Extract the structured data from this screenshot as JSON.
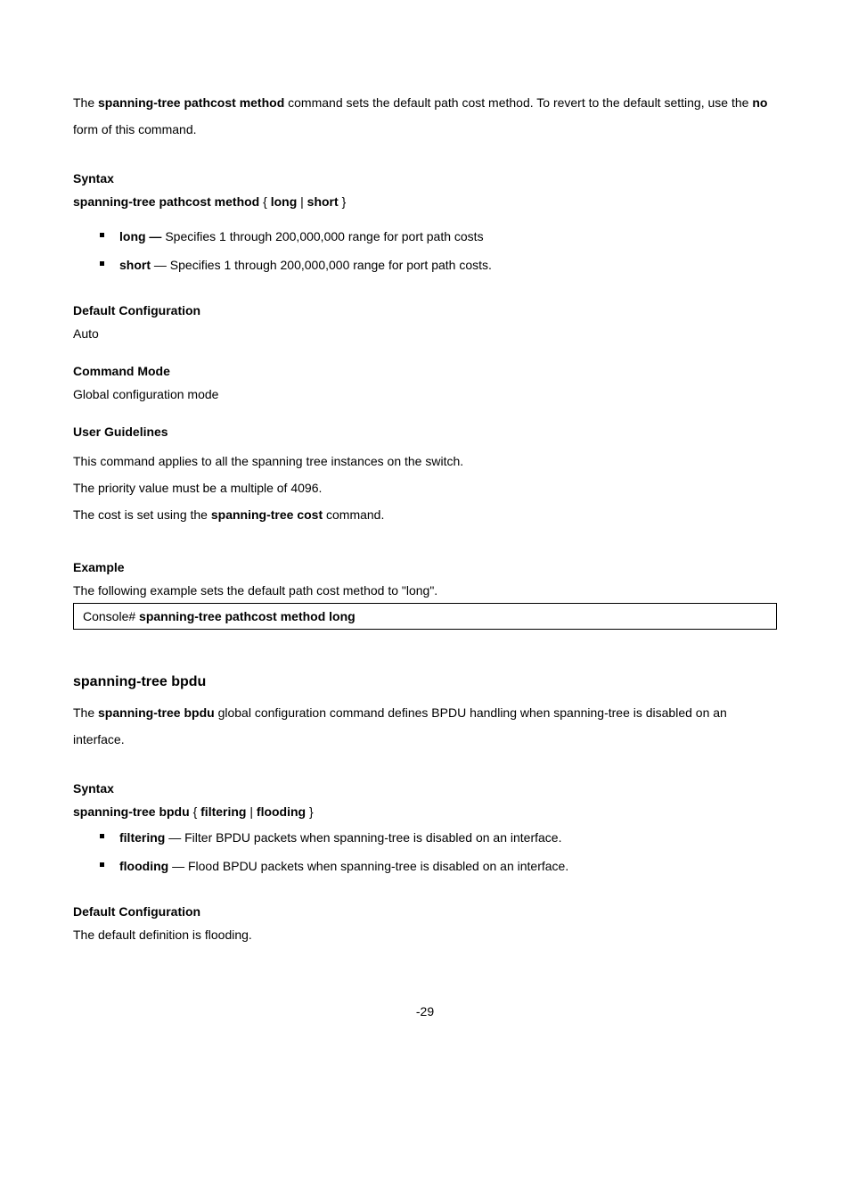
{
  "sec1": {
    "desc_pre": "The ",
    "desc_cmd": "spanning-tree pathcost method",
    "desc_mid": " command sets the default path cost method. To revert to the default setting, use the ",
    "desc_no": "no",
    "desc_post": " form of this command.",
    "syntax_hdr": "Syntax",
    "syntax_line": "spanning-tree pathcost method ",
    "syntax_open": "{",
    "syntax_a": " long ",
    "syntax_pipe": "|",
    "syntax_b": " short ",
    "syntax_close": "}",
    "bul1_k": "long — ",
    "bul1_v": "Specifies 1 through 200,000,000 range for port path costs",
    "bul2_k": "short ",
    "bul2_v": "— Specifies 1 through 200,000,000 range for port path costs.",
    "def_hdr": "Default Configuration",
    "def_val": "Auto",
    "mode_hdr": "Command Mode",
    "mode_val": "Global configuration mode",
    "ug_hdr": "User Guidelines",
    "ug1": "This command applies to all the spanning tree instances on the switch.",
    "ug2": "The priority value must be a multiple of 4096.",
    "ug3_pre": "The cost is set using the ",
    "ug3_cmd": "spanning-tree cost",
    "ug3_post": " command.",
    "ex_hdr": "Example",
    "ex_desc": "The following example sets the default path cost method to \"long\".",
    "console_pre": "Console# ",
    "console_cmd": "spanning-tree pathcost method long"
  },
  "sec2": {
    "title": "spanning-tree bpdu",
    "desc_pre": "The ",
    "desc_cmd": "spanning-tree bpdu",
    "desc_post": " global configuration command defines BPDU handling when spanning-tree is disabled on an interface.",
    "syntax_hdr": "Syntax",
    "syntax_line1": "spanning-tree bpdu ",
    "syntax_open": "{",
    "syntax_a": " filtering ",
    "syntax_pipe": "|",
    "syntax_b": " flooding ",
    "syntax_close": "}",
    "bul1_k": "filtering ",
    "bul1_v": "— Filter BPDU packets when spanning-tree is disabled on an interface.",
    "bul2_k": "flooding ",
    "bul2_v": "— Flood BPDU packets when spanning-tree is disabled on an interface.",
    "def_hdr": "Default Configuration",
    "def_val": "The default definition is flooding."
  },
  "pagenum": "-29"
}
